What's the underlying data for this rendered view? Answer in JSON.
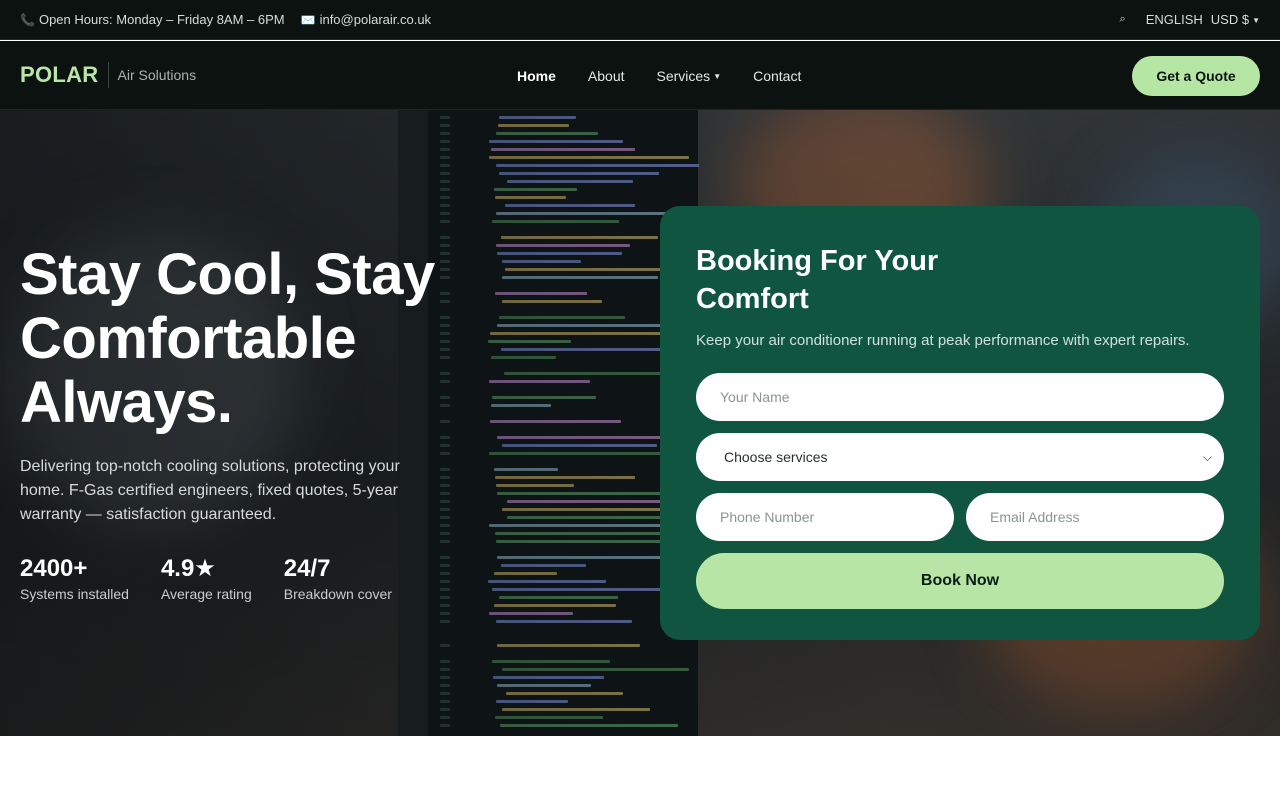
{
  "topbar": {
    "hours_icon": "phone-icon",
    "hours": "Open Hours: Monday – Friday 8AM – 6PM",
    "email_icon": "mail-icon",
    "email": "info@polarair.co.uk",
    "search_icon": "search-icon",
    "language": "ENGLISH",
    "currency": "USD $"
  },
  "nav": {
    "brand": "POLAR",
    "tagline": "Air Solutions",
    "links": [
      "Home",
      "About",
      "Services",
      "Contact"
    ],
    "cta": "Get a Quote"
  },
  "hero": {
    "headline": "Stay Cool, Stay Comfortable Always.",
    "subtext": "Delivering top-notch cooling solutions, protecting your home. F-Gas certified engineers, fixed quotes, 5-year warranty — satisfaction guaranteed.",
    "stats": [
      {
        "value": "2400+",
        "label": "Systems installed"
      },
      {
        "value": "4.9★",
        "label": "Average rating"
      },
      {
        "value": "24/7",
        "label": "Breakdown cover"
      }
    ]
  },
  "booking": {
    "title": "Booking For Your Comfort",
    "description": "Keep your air conditioner running at peak performance with expert repairs.",
    "name_placeholder": "Your Name",
    "service_select": "Choose services",
    "phone_placeholder": "Phone Number",
    "email_placeholder": "Email Address",
    "submit": "Book Now"
  },
  "colors": {
    "accent": "#b6e6a4",
    "card": "#0f5540",
    "dark": "#0b1210"
  }
}
